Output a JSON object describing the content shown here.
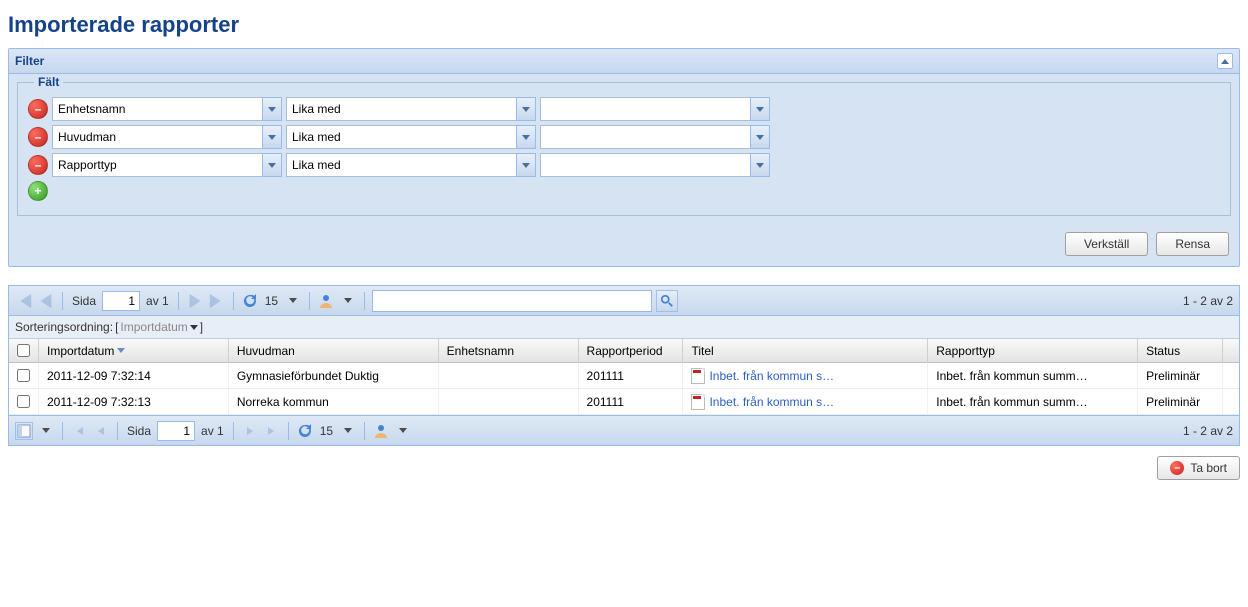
{
  "page_title": "Importerade rapporter",
  "filter_panel": {
    "title": "Filter",
    "fieldset_label": "Fält",
    "rows": [
      {
        "field": "Enhetsnamn",
        "operator": "Lika med",
        "value": ""
      },
      {
        "field": "Huvudman",
        "operator": "Lika med",
        "value": ""
      },
      {
        "field": "Rapporttyp",
        "operator": "Lika med",
        "value": ""
      }
    ],
    "apply_label": "Verkställ",
    "clear_label": "Rensa"
  },
  "grid": {
    "page_label_prefix": "Sida",
    "current_page": "1",
    "page_label_suffix": "av 1",
    "page_size": "15",
    "search_value": "",
    "range_text": "1 - 2 av 2",
    "sort_label": "Sorteringsordning:",
    "sort_field": "Importdatum",
    "columns": {
      "importdatum": "Importdatum",
      "huvudman": "Huvudman",
      "enhetsnamn": "Enhetsnamn",
      "rapportperiod": "Rapportperiod",
      "titel": "Titel",
      "rapporttyp": "Rapporttyp",
      "status": "Status"
    },
    "rows": [
      {
        "importdatum": "2011-12-09 7:32:14",
        "huvudman": "Gymnasieförbundet Duktig",
        "enhetsnamn": "",
        "rapportperiod": "201111",
        "titel": "Inbet. från kommun s…",
        "rapporttyp": "Inbet. från kommun summ…",
        "status": "Preliminär"
      },
      {
        "importdatum": "2011-12-09 7:32:13",
        "huvudman": "Norreka kommun",
        "enhetsnamn": "",
        "rapportperiod": "201111",
        "titel": "Inbet. från kommun s…",
        "rapporttyp": "Inbet. från kommun summ…",
        "status": "Preliminär"
      }
    ]
  },
  "delete_label": "Ta bort"
}
